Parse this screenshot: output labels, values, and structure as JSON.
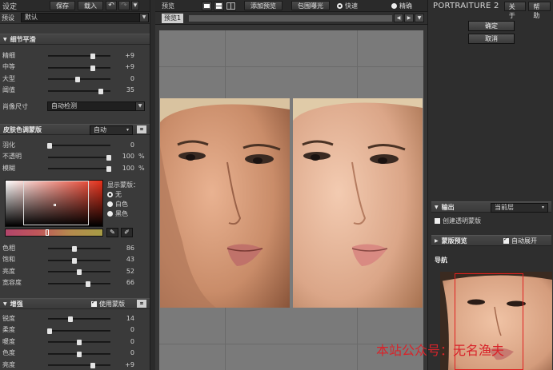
{
  "left": {
    "title": "设定",
    "save_label": "保存",
    "load_label": "载入",
    "undo_icon": "undo-icon",
    "redo_icon": "redo-icon",
    "close_icon": "close-icon",
    "preset_label": "预设",
    "preset_value": "默认",
    "detail_section": {
      "title": "细节平滑",
      "sliders": [
        {
          "label": "精细",
          "value": "+9",
          "pos": 0.72
        },
        {
          "label": "中等",
          "value": "+9",
          "pos": 0.72
        },
        {
          "label": "大型",
          "value": "0",
          "pos": 0.48
        },
        {
          "label": "阈值",
          "value": "35",
          "pos": 0.84
        }
      ],
      "size_label": "肖像尺寸",
      "size_value": "自动检测"
    },
    "mask_section": {
      "title": "皮肤色调蒙版",
      "mode_value": "自动",
      "sliders": [
        {
          "label": "羽化",
          "value": "0",
          "unit": "",
          "pos": 0.02
        },
        {
          "label": "不透明",
          "value": "100",
          "unit": "%",
          "pos": 0.98
        },
        {
          "label": "模糊",
          "value": "100",
          "unit": "%",
          "pos": 0.98
        }
      ],
      "show_mask_label": "显示蒙版：",
      "show_mask_options": [
        "无",
        "白色",
        "黑色"
      ],
      "show_mask_selected": 0,
      "tone_sliders": [
        {
          "label": "色相",
          "value": "86",
          "pos": 0.42
        },
        {
          "label": "饱和",
          "value": "43",
          "pos": 0.42
        },
        {
          "label": "亮度",
          "value": "52",
          "pos": 0.5
        },
        {
          "label": "宽容度",
          "value": "66",
          "pos": 0.64
        }
      ]
    },
    "enhance_section": {
      "title": "增强",
      "use_mask_label": "使用蒙版",
      "use_mask_checked": true,
      "sliders": [
        {
          "label": "锐度",
          "value": "14",
          "pos": 0.36
        },
        {
          "label": "柔度",
          "value": "0",
          "pos": 0.02
        },
        {
          "label": "暖度",
          "value": "0",
          "pos": 0.5
        },
        {
          "label": "色度",
          "value": "0",
          "pos": 0.5
        },
        {
          "label": "亮度",
          "value": "+9",
          "pos": 0.72
        }
      ]
    }
  },
  "center": {
    "title": "预览",
    "add_preview_label": "添加预览",
    "color_expose_label": "包围曝光",
    "mode_options": [
      "快速",
      "精确"
    ],
    "mode_selected": 0,
    "tab_label": "预览1"
  },
  "right": {
    "brand": "PORTRAITURE 2",
    "about_label": "关于",
    "help_label": "帮助",
    "ok_label": "确定",
    "cancel_label": "取消",
    "output_section": {
      "title": "输出",
      "target_value": "当前层",
      "create_mask_label": "创建透明蒙版",
      "create_mask_checked": false
    },
    "mask_preview_section": {
      "title": "蒙版预览",
      "auto_expand_label": "自动展开",
      "auto_expand_checked": true
    },
    "navigator_title": "导航"
  },
  "watermark": "本站公众号：无名渔夫"
}
